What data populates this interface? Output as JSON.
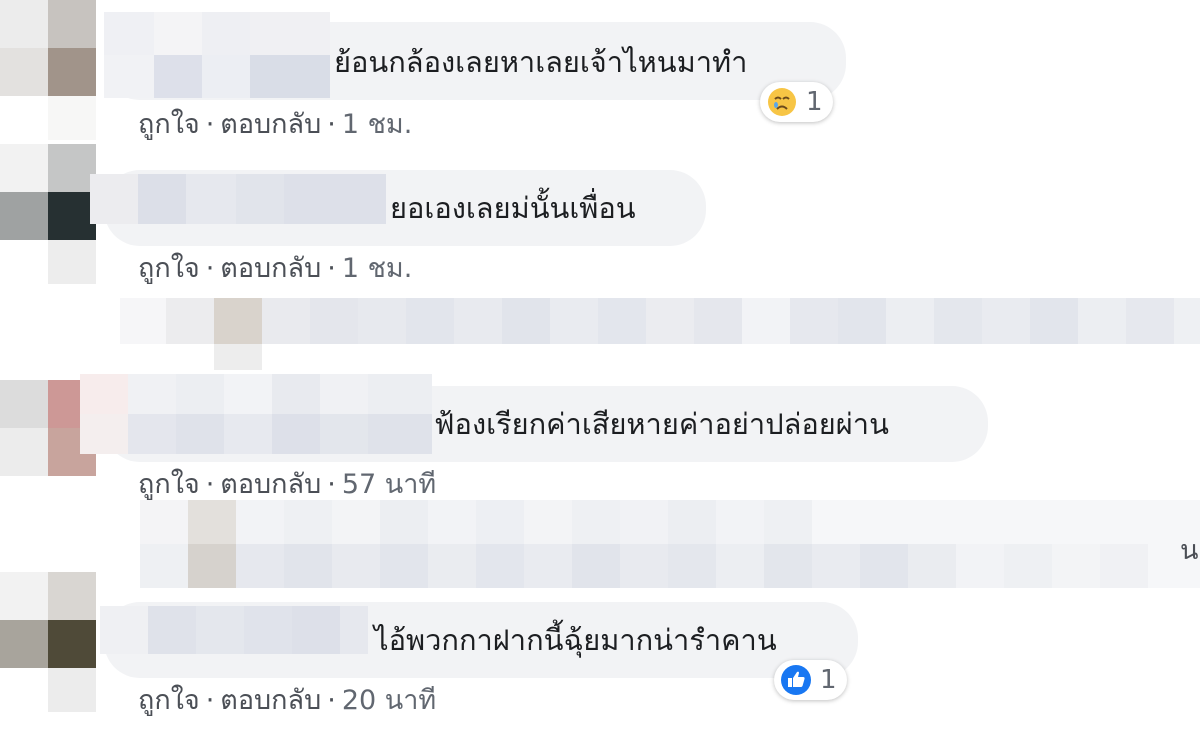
{
  "colors": {
    "bubble": "#f2f3f5",
    "action_text": "#4b4f56",
    "like_blue": "#1877f2",
    "sad_yellow": "#f7c545"
  },
  "comments": [
    {
      "text": "ย้อนกล้องเลยหาเลยเจ้าไหนมาทำ",
      "like": "ถูกใจ",
      "reply": "ตอบกลับ",
      "time": "1 ชม.",
      "reaction_icon": "sad-face-icon",
      "reaction_count": "1"
    },
    {
      "text": "ยอเองเลยม่นั้นเพื่อน",
      "like": "ถูกใจ",
      "reply": "ตอบกลับ",
      "time": "1 ชม."
    },
    {
      "text": "ฟ้องเรียกค่าเสียหายค่าอย่าปล่อยผ่าน",
      "like": "ถูกใจ",
      "reply": "ตอบกลับ",
      "time": "57 นาที"
    },
    {
      "text": "ไอ้พวกกาฝากนี้ฉุ้ยมากน่ารำคาน",
      "like": "ถูกใจ",
      "reply": "ตอบกลับ",
      "time": "20 นาที",
      "reaction_icon": "like-thumb-icon",
      "reaction_count": "1"
    }
  ],
  "separator": "·",
  "edge_text": "น"
}
